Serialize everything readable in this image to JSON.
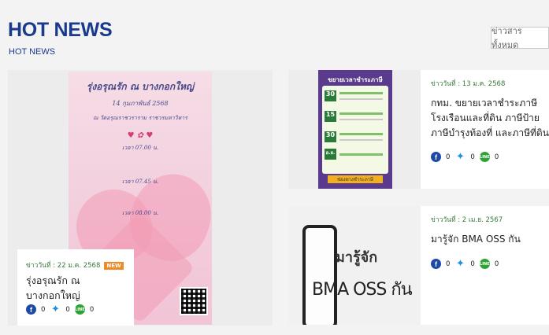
{
  "header": {
    "title": "HOT NEWS",
    "subtitle": "HOT NEWS",
    "all_news_button": "ข่าวสารทั้งหมด"
  },
  "featured": {
    "poster_title": "รุ่งอรุณรัก ณ บางกอกใหญ่",
    "poster_date": "14 กุมภาพันธ์ 2568",
    "poster_venue": "ณ วัดอรุณราชวราราม ราชวรมหาวิหาร",
    "poster_time_1": "เวลา 07.00 น.",
    "poster_time_2": "เวลา 07.45 น.",
    "poster_time_3": "เวลา 08.00 น.",
    "date_label": "ข่าววันที่ : 22 ม.ค. 2568",
    "badge": "NEW",
    "headline": "รุ่งอรุณรัก ณ บางกอกใหญ่",
    "shares": {
      "facebook": "0",
      "twitter": "0",
      "line": "0"
    }
  },
  "news": [
    {
      "thumb_title": "ขยายเวลาชำระภาษี",
      "thumb_rows": [
        "30",
        "15",
        "30",
        "อ.ย."
      ],
      "thumb_footer": "ช่องทางชำระภาษี",
      "date_label": "ข่าววันที่ : 13 ม.ค. 2568",
      "headline": "กทม. ขยายเวลาชำระภาษีโรงเรือนและที่ดิน ภาษีป้าย ภาษีบำรุงท้องที่ และภาษีที่ดินแล..",
      "shares": {
        "facebook": "0",
        "twitter": "0",
        "line": "0"
      }
    },
    {
      "thumb_title": "มารู้จัก",
      "thumb_subtitle": "BMA OSS กัน",
      "date_label": "ข่าววันที่ : 2 เม.ย. 2567",
      "headline": "มารู้จัก BMA OSS กัน",
      "shares": {
        "facebook": "0",
        "twitter": "0",
        "line": "0"
      }
    }
  ],
  "icons": {
    "facebook": "facebook-icon",
    "twitter": "twitter-icon",
    "line": "line-icon"
  },
  "colors": {
    "title": "#1a3a8c",
    "date": "#3a7a3a",
    "badge": "#f08a24",
    "facebook": "#1d4aa8",
    "twitter": "#1d8fe0",
    "line": "#2da336"
  }
}
